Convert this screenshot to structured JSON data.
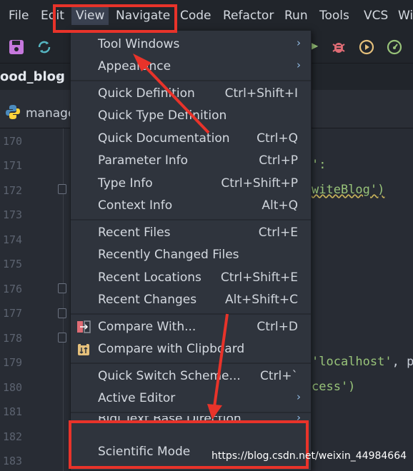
{
  "menubar": {
    "items": [
      "File",
      "Edit",
      "View",
      "Navigate",
      "Code",
      "Refactor",
      "Run",
      "Tools",
      "VCS",
      "Wi"
    ]
  },
  "breadcrumb": {
    "project": "ood_blog"
  },
  "tab": {
    "label": "manage"
  },
  "line_numbers": [
    "170",
    "171",
    "172",
    "173",
    "174",
    "175",
    "176",
    "177",
    "178",
    "179",
    "180",
    "181",
    "182",
    "183"
  ],
  "code": {
    "line171": "':",
    "line172": "witeBlog')",
    "line179_str": "'localhost'",
    "line179_rest": ", p",
    "line180": "cess')"
  },
  "view_menu": {
    "tool_windows": "Tool Windows",
    "appearance": "Appearance",
    "quick_definition": "Quick Definition",
    "quick_definition_sc": "Ctrl+Shift+I",
    "quick_type_definition": "Quick Type Definition",
    "quick_documentation": "Quick Documentation",
    "quick_documentation_sc": "Ctrl+Q",
    "parameter_info": "Parameter Info",
    "parameter_info_sc": "Ctrl+P",
    "type_info": "Type Info",
    "type_info_sc": "Ctrl+Shift+P",
    "context_info": "Context Info",
    "context_info_sc": "Alt+Q",
    "recent_files": "Recent Files",
    "recent_files_sc": "Ctrl+E",
    "recently_changed_files": "Recently Changed Files",
    "recent_locations": "Recent Locations",
    "recent_locations_sc": "Ctrl+Shift+E",
    "recent_changes": "Recent Changes",
    "recent_changes_sc": "Alt+Shift+C",
    "compare_with": "Compare With...",
    "compare_with_sc": "Ctrl+D",
    "compare_clipboard": "Compare with Clipboard",
    "quick_switch_scheme": "Quick Switch Scheme...",
    "quick_switch_scheme_sc": "Ctrl+`",
    "active_editor": "Active Editor",
    "bidi_text": "Bidi Text Base Direction",
    "scientific_mode": "Scientific Mode"
  },
  "watermark": "https://blog.csdn.net/weixin_44984664",
  "colors": {
    "annotation_red": "#e8332a",
    "menu_bg": "#2f343d",
    "editor_bg": "#282c34"
  },
  "icons": [
    "save-icon",
    "sync-icon",
    "debug-bug-icon",
    "run-coverage-icon",
    "profile-icon",
    "python-file-icon",
    "compare-icon",
    "clipboard-compare-icon"
  ]
}
